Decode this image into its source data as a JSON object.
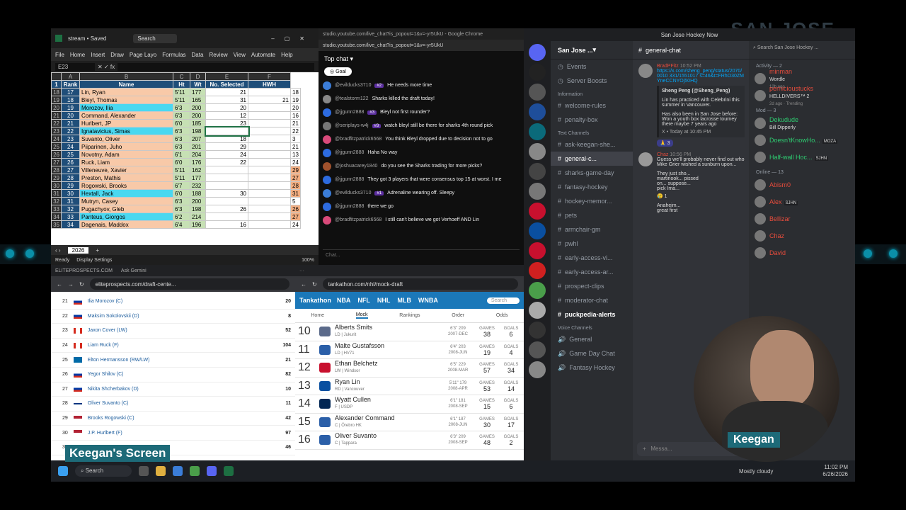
{
  "background_text": "SAN JOSE",
  "excel": {
    "title": "stream • Saved",
    "search": "Search",
    "menu": [
      "File",
      "Home",
      "Insert",
      "Draw",
      "Page Layo",
      "Formulas",
      "Data",
      "Review",
      "View",
      "Automate",
      "Help"
    ],
    "cell_ref": "E23",
    "headers": [
      "Rank",
      "Name",
      "Ht",
      "Wt",
      "No. Selected",
      "HWH"
    ],
    "col_letters": [
      "A",
      "B",
      "C",
      "D",
      "E",
      "F"
    ],
    "rows": [
      {
        "r": "18",
        "rank": "17",
        "name": "Lin, Ryan",
        "ht": "5'11",
        "wt": "177",
        "sel": "21",
        "hwh": "",
        "x": "18",
        "hl": "orange"
      },
      {
        "r": "19",
        "rank": "18",
        "name": "Bleyl, Thomas",
        "ht": "5'11",
        "wt": "165",
        "sel": "31",
        "hwh": "21",
        "x": "19",
        "hl": "orange"
      },
      {
        "r": "20",
        "rank": "19",
        "name": "Morozov, Ilia",
        "ht": "6'3",
        "wt": "200",
        "sel": "20",
        "hwh": "",
        "x": "20",
        "hl": "cyan"
      },
      {
        "r": "21",
        "rank": "20",
        "name": "Command, Alexander",
        "ht": "6'3",
        "wt": "200",
        "sel": "12",
        "hwh": "",
        "x": "16",
        "hl": "orange"
      },
      {
        "r": "22",
        "rank": "21",
        "name": "Hurlbert, JP",
        "ht": "6'0",
        "wt": "185",
        "sel": "23",
        "hwh": "",
        "x": "21",
        "hl": "orange"
      },
      {
        "r": "23",
        "rank": "22",
        "name": "Ignatavicius, Simas",
        "ht": "6'3",
        "wt": "198",
        "sel": "",
        "hwh": "",
        "x": "22",
        "hl": "cyan"
      },
      {
        "r": "24",
        "rank": "23",
        "name": "Suvanto, Oliver",
        "ht": "6'3",
        "wt": "207",
        "sel": "18",
        "hwh": "",
        "x": "3",
        "hl": "orange"
      },
      {
        "r": "25",
        "rank": "24",
        "name": "Piiparinen, Juho",
        "ht": "6'3",
        "wt": "201",
        "sel": "29",
        "hwh": "",
        "x": "21",
        "hl": "orange"
      },
      {
        "r": "26",
        "rank": "25",
        "name": "Novotny, Adam",
        "ht": "6'1",
        "wt": "204",
        "sel": "24",
        "hwh": "",
        "x": "13",
        "hl": "orange"
      },
      {
        "r": "27",
        "rank": "26",
        "name": "Ruck, Liam",
        "ht": "6'0",
        "wt": "176",
        "sel": "22",
        "hwh": "",
        "x": "24",
        "hl": "orange"
      },
      {
        "r": "28",
        "rank": "27",
        "name": "Villeneuve, Xavier",
        "ht": "5'11",
        "wt": "162",
        "sel": "",
        "hwh": "",
        "x": "29",
        "hl": "orange"
      },
      {
        "r": "29",
        "rank": "28",
        "name": "Preston, Mathis",
        "ht": "5'11",
        "wt": "177",
        "sel": "",
        "hwh": "",
        "x": "27",
        "hl": "orange"
      },
      {
        "r": "30",
        "rank": "29",
        "name": "Rogowski, Brooks",
        "ht": "6'7",
        "wt": "232",
        "sel": "",
        "hwh": "",
        "x": "28",
        "hl": "orange"
      },
      {
        "r": "31",
        "rank": "30",
        "name": "Hextall, Jack",
        "ht": "6'0",
        "wt": "188",
        "sel": "30",
        "hwh": "",
        "x": "31",
        "hl": "cyan"
      },
      {
        "r": "32",
        "rank": "31",
        "name": "Mutryn, Casey",
        "ht": "6'3",
        "wt": "200",
        "sel": "",
        "hwh": "",
        "x": "5",
        "hl": "orange"
      },
      {
        "r": "33",
        "rank": "32",
        "name": "Pugachyov, Gleb",
        "ht": "6'3",
        "wt": "198",
        "sel": "26",
        "hwh": "",
        "x": "26",
        "hl": "orange"
      },
      {
        "r": "34",
        "rank": "33",
        "name": "Panteus, Giorgos",
        "ht": "6'2",
        "wt": "214",
        "sel": "",
        "hwh": "",
        "x": "27",
        "hl": "cyan"
      },
      {
        "r": "35",
        "rank": "34",
        "name": "Dagenais, Maddox",
        "ht": "6'4",
        "wt": "196",
        "sel": "16",
        "hwh": "",
        "x": "24",
        "hl": "orange"
      }
    ],
    "sheet_tab": "2026",
    "status_ready": "Ready",
    "status_display": "Display Settings",
    "zoom": "100%"
  },
  "youtube": {
    "title": "studio.youtube.com/live_chat?is_popout=1&v=-yr5UkU - Google Chrome",
    "url": "studio.youtube.com/live_chat?is_popout=1&v=-yr5UkU",
    "top_chat": "Top chat",
    "goal": "Goal",
    "input_placeholder": "Chat...",
    "messages": [
      {
        "user": "@evilducks3710",
        "badge": "#2",
        "text": "He needs more time",
        "color": "#3b7dd8"
      },
      {
        "user": "@tealstorm122",
        "badge": "",
        "text": "Sharks killed the draft today!",
        "color": "#888"
      },
      {
        "user": "@jjgunn2888",
        "badge": "#3",
        "text": "Bleyl not first rounder?",
        "color": "#2d6be0"
      },
      {
        "user": "@seriplays-w4j",
        "badge": "#3",
        "text": "watch bleyl still be there for sharks 4th round pick",
        "color": "#777"
      },
      {
        "user": "@bradfitzpatrick6568",
        "badge": "",
        "text": "You think Bleyl dropped due to decision not to go",
        "color": "#d94a7a"
      },
      {
        "user": "@jjgunn2888",
        "badge": "",
        "text": "Haha No way",
        "color": "#2d6be0"
      },
      {
        "user": "@joshuacarey1840",
        "badge": "",
        "text": "do you see the Sharks trading for more picks?",
        "color": "#a0522d"
      },
      {
        "user": "@jjgunn2888",
        "badge": "",
        "text": "They got 3 players that were consensus top 15 at worst. I me",
        "color": "#2d6be0"
      },
      {
        "user": "@evilducks3710",
        "badge": "#1",
        "text": "Adrenaline wearing off. Sleepy",
        "color": "#3b7dd8"
      },
      {
        "user": "@jjgunn2888",
        "badge": "",
        "text": "there we go",
        "color": "#2d6be0"
      },
      {
        "user": "@bradfitzpatrick6568",
        "badge": "",
        "text": "I still can't believe we got Verhoeff AND Lin",
        "color": "#d94a7a"
      }
    ]
  },
  "discord": {
    "window_title": "San Jose Hockey Now",
    "server_name": "San Jose ...",
    "channel_name": "general-chat",
    "search": "Search San Jose Hockey ...",
    "top_items": [
      "Events",
      "Server Boosts"
    ],
    "info_label": "Information",
    "info_channels": [
      "welcome-rules",
      "penalty-box"
    ],
    "text_label": "Text Channels",
    "text_channels": [
      "ask-keegan-she...",
      "general-c...",
      "sharks-game-day",
      "fantasy-hockey",
      "hockey-memor...",
      "pets",
      "armchair-gm",
      "pwhl",
      "early-access-vi...",
      "early-access-ar...",
      "prospect-clips",
      "moderator-chat",
      "puckpedia-alerts"
    ],
    "voice_label": "Voice Channels",
    "voice_channels": [
      "General",
      "Game Day Chat",
      "Fantasy Hockey"
    ],
    "msg1": {
      "user": "BradPFitz",
      "time": "10:52 PM",
      "tag": "SJHN",
      "link": "https://x.com/sheng_peng/status/2070/0010 331/1551017 s=46&t=FRhO30ZMYneCCNYOj50HQ",
      "embed_author": "Sheng Peng (@Sheng_Peng)",
      "embed_text1": "Lin has practiced with Celebrini this summer in Vancouver.",
      "embed_text2": "Has also been in San Jose before: Won a youth box lacrosse tourney there maybe 7 years ago",
      "embed_footer": "X • Today at 10:45 PM",
      "reaction": "3"
    },
    "msg2": {
      "user": "Chaz",
      "time": "10:56 PM",
      "text": "Guess we'll probably never find out who Mike Grier wished a sunburn upon...",
      "text2": "They just sho... martinook... pissed on... suppose... pick Ima...",
      "reaction": "1"
    },
    "msg3_text": "Anaheim... great first",
    "input_placeholder": "Messa...",
    "members": {
      "activity_label": "Activity — 2",
      "activity": [
        {
          "name": "minman",
          "sub": "Wordle",
          "sub2": "12h ago"
        },
        {
          "name": "pernicioustucks",
          "sub": "HELLDIVERS™ 2",
          "sub2": "2d ago · Trending"
        }
      ],
      "mod_label": "Mod — 3",
      "mods": [
        {
          "name": "Dekudude",
          "sub": "Bill Dipperly"
        },
        {
          "name": "Doesn'tKnowHo...",
          "tag": "MOZA"
        },
        {
          "name": "Half-wall Hoc...",
          "tag": "SJHN"
        }
      ],
      "online_label": "Online — 13",
      "online": [
        {
          "name": "Abism0"
        },
        {
          "name": "Alex",
          "tag": "SJHN"
        },
        {
          "name": "Bellizar"
        },
        {
          "name": "Chaz"
        },
        {
          "name": "David"
        }
      ]
    }
  },
  "elite": {
    "tab1": "ELITEPROSPECTS.COM",
    "tab2": "Ask Gemini",
    "url": "eliteprospects.com/draft-cente...",
    "rows": [
      {
        "n": "21",
        "name": "Ilia Morozov (C)",
        "v": "20",
        "flag": "ru"
      },
      {
        "n": "22",
        "name": "Maksim Sokolovskii (D)",
        "v": "8",
        "flag": "ru"
      },
      {
        "n": "23",
        "name": "Jaxon Cover (LW)",
        "v": "52",
        "flag": "ca"
      },
      {
        "n": "24",
        "name": "Liam Ruck (F)",
        "v": "104",
        "flag": "ca"
      },
      {
        "n": "25",
        "name": "Elton Hermansson (RW/LW)",
        "v": "21",
        "flag": "se"
      },
      {
        "n": "26",
        "name": "Yegor Shilov (C)",
        "v": "82",
        "flag": "ru"
      },
      {
        "n": "27",
        "name": "Nikita Shcherbakov (D)",
        "v": "10",
        "flag": "ru"
      },
      {
        "n": "28",
        "name": "Oliver Suvanto (C)",
        "v": "11",
        "flag": "fi"
      },
      {
        "n": "29",
        "name": "Brooks Rogowski (C)",
        "v": "42",
        "flag": "us"
      },
      {
        "n": "30",
        "name": "J.P. Hurlbert (F)",
        "v": "97",
        "flag": "us"
      },
      {
        "n": "31",
        "name": "",
        "v": "46",
        "flag": "us"
      }
    ]
  },
  "tankathon": {
    "url": "tankathon.com/nhl/mock-draft",
    "brand": "Tankathon",
    "leagues": [
      "NBA",
      "NFL",
      "NHL",
      "MLB",
      "WNBA"
    ],
    "search": "Search",
    "nav": [
      "Home",
      "Mock",
      "Rankings",
      "Order",
      "Odds"
    ],
    "rows": [
      {
        "n": "10",
        "name": "Alberts Smits",
        "sub": "LD | Jukurit",
        "ht": "6'3\" 209",
        "bd": "2007-DEC",
        "gp": "38",
        "g": "6",
        "logo": "#5b6a8a"
      },
      {
        "n": "11",
        "name": "Malte Gustafsson",
        "sub": "LD | HV71",
        "ht": "6'4\" 203",
        "bd": "2008-JUN",
        "gp": "19",
        "g": "4",
        "logo": "#2b5fa8"
      },
      {
        "n": "12",
        "name": "Ethan Belchetz",
        "sub": "LW | Windsor",
        "ht": "6'5\" 229",
        "bd": "2008-MAR",
        "gp": "57",
        "g": "34",
        "logo": "#c8102e"
      },
      {
        "n": "13",
        "name": "Ryan Lin",
        "sub": "RD | Vancouver",
        "ht": "5'11\" 179",
        "bd": "2008-APR",
        "gp": "53",
        "g": "14",
        "logo": "#0a4fa0"
      },
      {
        "n": "14",
        "name": "Wyatt Cullen",
        "sub": "F | USDP",
        "ht": "6'1\" 181",
        "bd": "2008-SEP",
        "gp": "15",
        "g": "6",
        "logo": "#002654"
      },
      {
        "n": "15",
        "name": "Alexander Command",
        "sub": "C | Örebro HK",
        "ht": "6'1\" 187",
        "bd": "2008-JUN",
        "gp": "30",
        "g": "17",
        "logo": "#2b5fa8"
      },
      {
        "n": "16",
        "name": "Oliver Suvanto",
        "sub": "C | Tappara",
        "ht": "6'3\" 209",
        "bd": "2008-SEP",
        "gp": "48",
        "g": "2",
        "logo": "#2b5fa8"
      }
    ]
  },
  "taskbar": {
    "search": "Search",
    "weather": "Mostly cloudy",
    "time": "11:02 PM",
    "date": "6/26/2026"
  },
  "labels": {
    "screen": "Keegan's Screen",
    "cam": "Keegan"
  }
}
